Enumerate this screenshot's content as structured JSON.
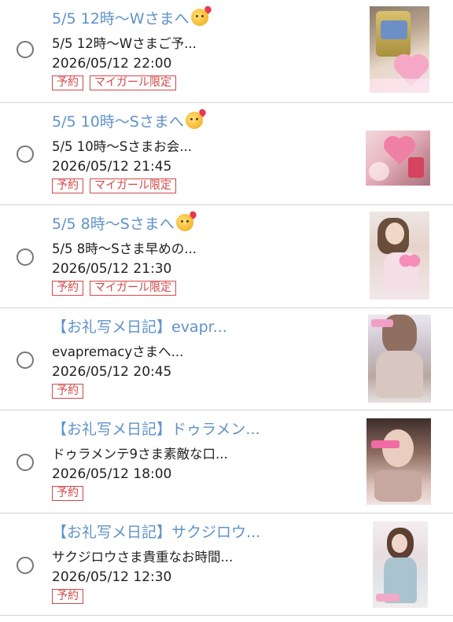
{
  "entries": [
    {
      "title": "5/5 12時〜Wさまへ",
      "title_emoji": "smiling-face-with-hearts-emoji",
      "snippet": "5/5 12時〜Wさまご予...",
      "date": "2026/05/12 22:00",
      "tags": [
        "予約",
        "マイガール限定"
      ],
      "thumbnail": "photo-thumbnail"
    },
    {
      "title": "5/5 10時〜Sさまへ",
      "title_emoji": "smiling-face-with-hearts-emoji",
      "snippet": "5/5 10時〜Sさまお会...",
      "date": "2026/05/12 21:45",
      "tags": [
        "予約",
        "マイガール限定"
      ],
      "thumbnail": "photo-thumbnail"
    },
    {
      "title": "5/5 8時〜Sさまへ",
      "title_emoji": "smiling-face-with-hearts-emoji",
      "snippet": "5/5 8時〜Sさま早めの...",
      "date": "2026/05/12 21:30",
      "tags": [
        "予約",
        "マイガール限定"
      ],
      "thumbnail": "photo-thumbnail"
    },
    {
      "title": "【お礼写メ日記】evapr...",
      "title_emoji": "",
      "snippet": "evapremacyさまへ...",
      "date": "2026/05/12 20:45",
      "tags": [
        "予約"
      ],
      "thumbnail": "photo-thumbnail"
    },
    {
      "title": "【お礼写メ日記】ドゥラメン...",
      "title_emoji": "",
      "snippet": "ドゥラメンテ9さま素敵な口...",
      "date": "2026/05/12 18:00",
      "tags": [
        "予約"
      ],
      "thumbnail": "photo-thumbnail"
    },
    {
      "title": "【お礼写メ日記】サクジロウ...",
      "title_emoji": "",
      "snippet": "サクジロウさま貴重なお時間...",
      "date": "2026/05/12 12:30",
      "tags": [
        "予約"
      ],
      "thumbnail": "photo-thumbnail"
    }
  ],
  "colors": {
    "title": "#5f92c9",
    "tag_border": "#d24848",
    "divider": "#d4d4d4"
  }
}
